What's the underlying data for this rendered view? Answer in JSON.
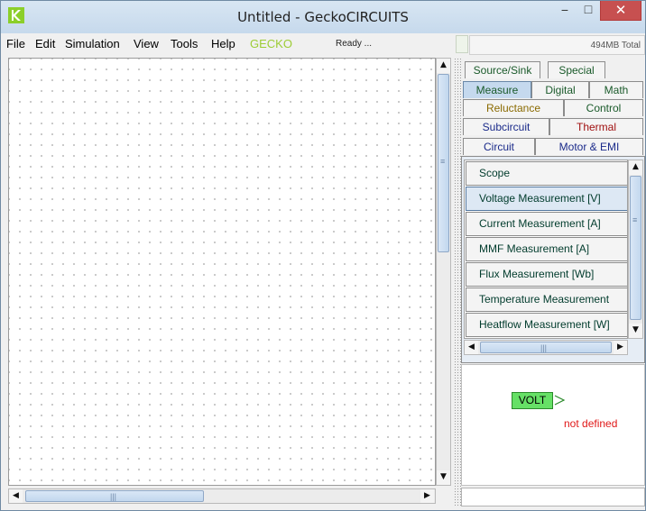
{
  "window": {
    "title": "Untitled  -  GeckoCIRCUITS",
    "minimize_glyph": "−",
    "maximize_glyph": "□",
    "close_glyph": "✕"
  },
  "menu": {
    "items": [
      "File",
      "Edit",
      "Simulation",
      "View",
      "Tools",
      "Help"
    ],
    "gecko": "GECKO",
    "status": "Ready ..."
  },
  "memory": "494MB Total",
  "tabs": {
    "row1": [
      "Source/Sink",
      "Special"
    ],
    "row2": [
      "Measure",
      "Digital",
      "Math"
    ],
    "row3": [
      "Reluctance",
      "Control"
    ],
    "row4": [
      "Subcircuit",
      "Thermal"
    ],
    "row5": [
      "Circuit",
      "Motor & EMI"
    ],
    "selected": "Measure",
    "colors": {
      "Source/Sink": "#1a5a2a",
      "Special": "#1a5a2a",
      "Measure": "#1a5a2a",
      "Digital": "#1a5a2a",
      "Math": "#1a5a2a",
      "Reluctance": "#8a6a00",
      "Control": "#1a5a2a",
      "Subcircuit": "#1a2a8a",
      "Thermal": "#a01010",
      "Circuit": "#1a2a8a",
      "Motor & EMI": "#1a2a8a"
    }
  },
  "components": [
    "Scope",
    "Voltage Measurement [V]",
    "Current Measurement [A]",
    "MMF Measurement [A]",
    "Flux Measurement [Wb]",
    "Temperature Measurement",
    "Heatflow Measurement [W]"
  ],
  "selected_component": "Voltage Measurement [V]",
  "preview": {
    "label": "VOLT",
    "note": "not defined"
  },
  "scroll": {
    "up": "▲",
    "down": "▼",
    "left": "◀",
    "right": "▶",
    "grip_v": "≡",
    "grip_h": "|||"
  }
}
